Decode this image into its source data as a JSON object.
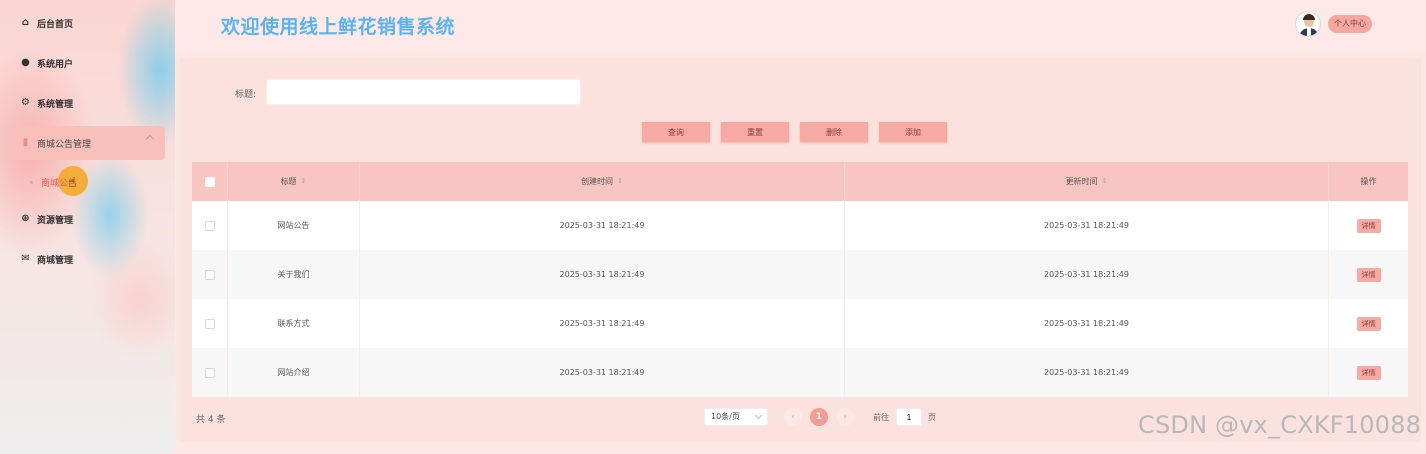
{
  "sidebar": {
    "items": [
      {
        "label": "后台首页",
        "icon": "home-icon",
        "glyph": "⌂"
      },
      {
        "label": "系统用户",
        "icon": "user-icon",
        "glyph": "●"
      },
      {
        "label": "系统管理",
        "icon": "settings-icon",
        "glyph": "⚙"
      },
      {
        "label": "商城公告管理",
        "icon": "document-icon",
        "glyph": "▮"
      },
      {
        "label": "资源管理",
        "icon": "circle-plus-icon",
        "glyph": "⊕"
      },
      {
        "label": "商城管理",
        "icon": "mail-icon",
        "glyph": "✉"
      }
    ],
    "submenu_label": "商城公告"
  },
  "header": {
    "title": "欢迎使用线上鲜花销售系统",
    "profile_label": "个人中心"
  },
  "search": {
    "label": "标题:",
    "value": "",
    "placeholder": ""
  },
  "buttons": {
    "query": "查询",
    "reset": "重置",
    "delete": "删除",
    "add": "添加"
  },
  "table": {
    "columns": {
      "title": "标题",
      "created": "创建时间",
      "updated": "更新时间",
      "ops": "操作"
    },
    "sort_glyph": "⇕",
    "detail_label": "详情",
    "rows": [
      {
        "title": "网站公告",
        "created": "2025-03-31 18:21:49",
        "updated": "2025-03-31 18:21:49"
      },
      {
        "title": "关于我们",
        "created": "2025-03-31 18:21:49",
        "updated": "2025-03-31 18:21:49"
      },
      {
        "title": "联系方式",
        "created": "2025-03-31 18:21:49",
        "updated": "2025-03-31 18:21:49"
      },
      {
        "title": "网站介绍",
        "created": "2025-03-31 18:21:49",
        "updated": "2025-03-31 18:21:49"
      }
    ]
  },
  "pagination": {
    "total": "共 4 条",
    "page_size": "10条/页",
    "prev": "‹",
    "current": "1",
    "next": "›",
    "goto_label": "前往",
    "goto_value": "1",
    "goto_unit": "页"
  },
  "watermark": "CSDN @vx_CXKF10088",
  "colors": {
    "accent": "#f6aaa3",
    "title_blue": "#5cb4ee",
    "active_page": "#f49b92",
    "header_row": "#f8c5c0"
  }
}
